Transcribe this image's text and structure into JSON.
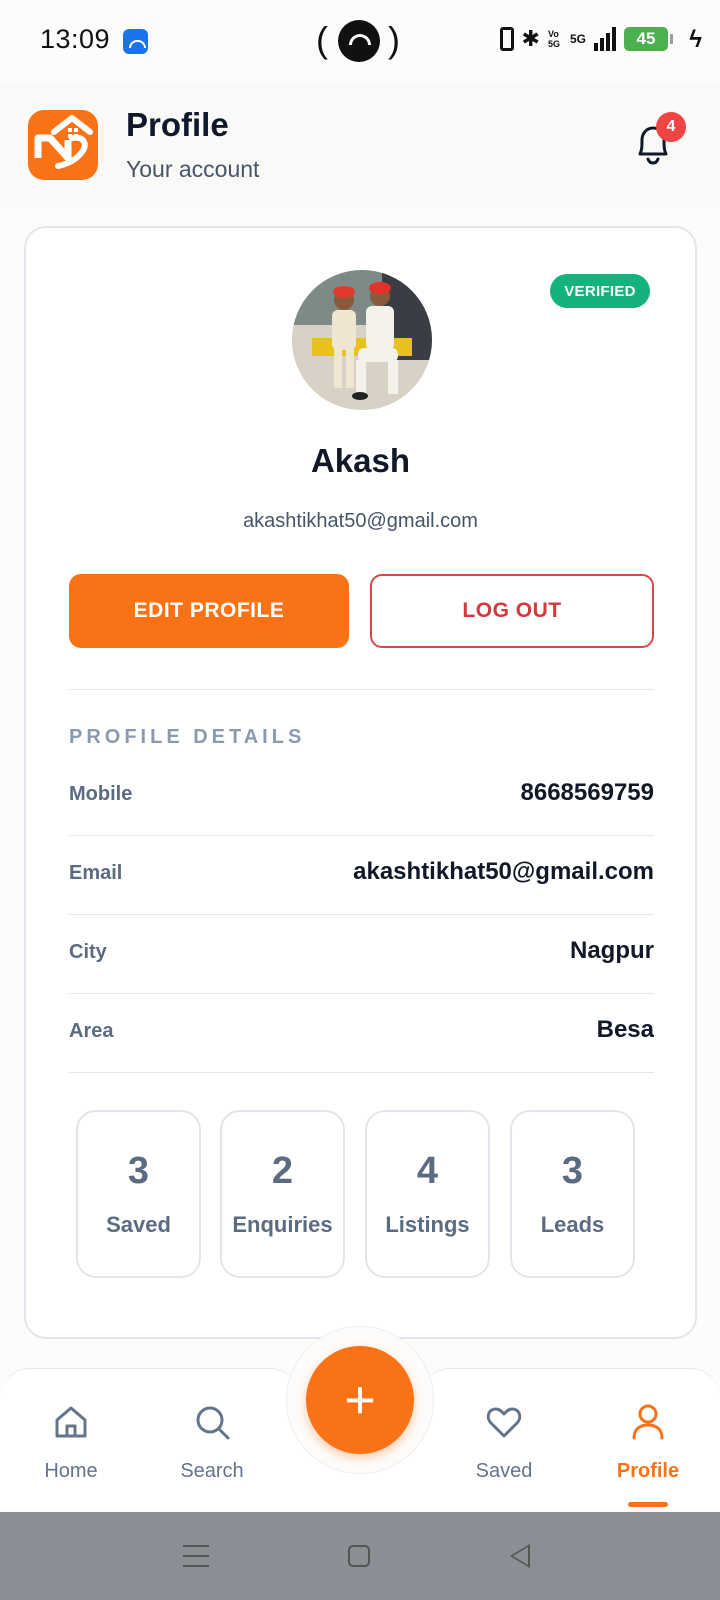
{
  "status_bar": {
    "time": "13:09",
    "network": "5G",
    "volte": "Vo 5G",
    "battery": "45",
    "icons": [
      "app-notification-icon",
      "hotspot-icon",
      "vibrate-icon",
      "bluetooth-icon",
      "signal-icon",
      "battery-icon",
      "charging-icon"
    ]
  },
  "header": {
    "title": "Profile",
    "subtitle": "Your account",
    "notification_count": "4"
  },
  "profile": {
    "name": "Akash",
    "email": "akashtikhat50@gmail.com",
    "verified_label": "VERIFIED"
  },
  "actions": {
    "edit_label": "EDIT PROFILE",
    "logout_label": "LOG OUT"
  },
  "details": {
    "section_title": "PROFILE DETAILS",
    "rows": [
      {
        "label": "Mobile",
        "value": "8668569759"
      },
      {
        "label": "Email",
        "value": "akashtikhat50@gmail.com"
      },
      {
        "label": "City",
        "value": "Nagpur"
      },
      {
        "label": "Area",
        "value": "Besa"
      }
    ]
  },
  "stats": [
    {
      "count": "3",
      "label": "Saved"
    },
    {
      "count": "2",
      "label": "Enquiries"
    },
    {
      "count": "4",
      "label": "Listings"
    },
    {
      "count": "3",
      "label": "Leads"
    }
  ],
  "nav": {
    "items": [
      {
        "label": "Home",
        "icon": "home-icon"
      },
      {
        "label": "Search",
        "icon": "search-icon"
      },
      {
        "label": "Saved",
        "icon": "heart-icon"
      },
      {
        "label": "Profile",
        "icon": "user-icon"
      }
    ],
    "fab_label": "+",
    "active": "Profile"
  },
  "colors": {
    "accent": "#f97316",
    "verified": "#14b37d",
    "danger": "#d23a3d",
    "badge": "#ef4444",
    "muted": "#5b6b82"
  }
}
